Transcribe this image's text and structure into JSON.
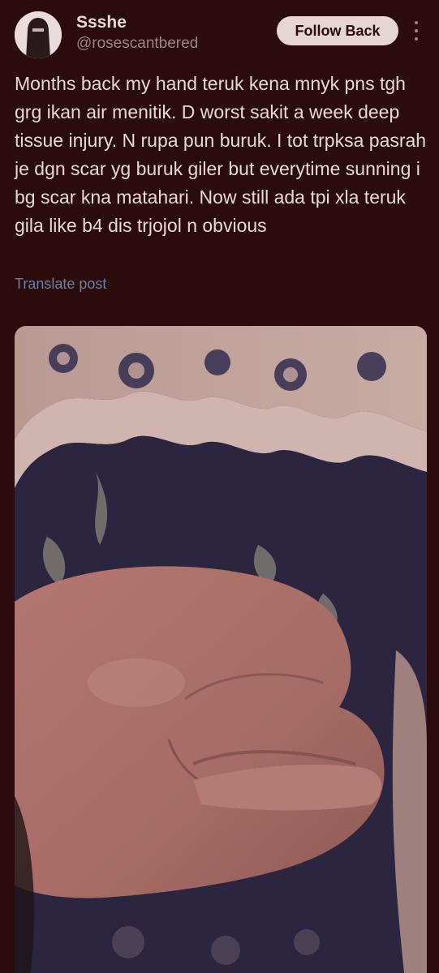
{
  "post": {
    "author_name": "Ssshe",
    "author_handle": "@rosescantbered",
    "follow_label": "Follow Back",
    "text": "Months back my hand teruk kena mnyk pns tgh grg ikan air menitik. D worst sakit a week deep tissue injury. N rupa pun buruk. I tot trpksa pasrah je dgn scar yg buruk giler but everytime sunning i bg scar kna matahari. Now still ada tpi xla teruk gila like b4 dis trjojol n obvious",
    "translate_label": "Translate post"
  },
  "icons": {
    "more": "more-vertical-icon",
    "avatar": "veiled-person-avatar"
  },
  "colors": {
    "background": "#2b0b0c",
    "text": "#e8d9d6",
    "muted": "#9b8583",
    "link": "#6d7fa6",
    "button_bg": "#e6d6d3"
  }
}
